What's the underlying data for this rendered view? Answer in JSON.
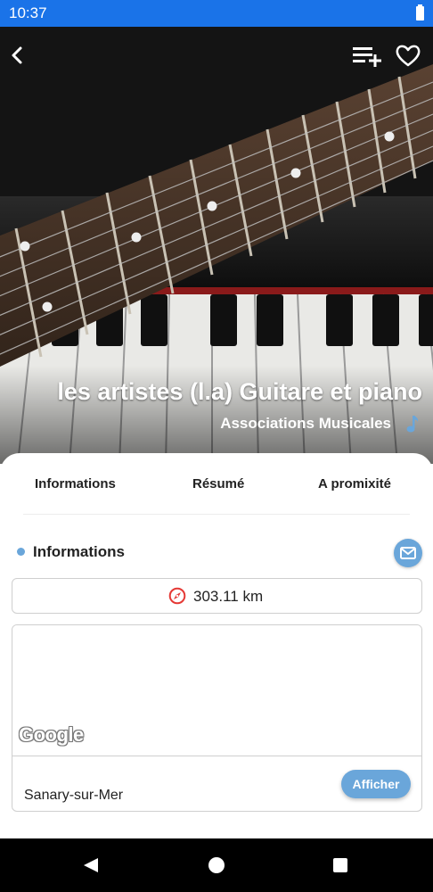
{
  "status_bar": {
    "time": "10:37"
  },
  "hero": {
    "title": "les artistes (l.a) Guitare et piano",
    "category": "Associations Musicales"
  },
  "tabs": [
    {
      "label": "Informations"
    },
    {
      "label": "Résumé"
    },
    {
      "label": "A promixité"
    }
  ],
  "info_section": {
    "title": "Informations",
    "distance": "303.11 km"
  },
  "map": {
    "attribution": "Google",
    "city": "Sanary-sur-Mer",
    "show_button": "Afficher"
  },
  "colors": {
    "status_bar": "#1a73e8",
    "accent": "#6aa6da",
    "compass": "#e53935"
  },
  "icons": [
    "back-arrow-icon",
    "playlist-add-icon",
    "heart-icon",
    "music-note-icon",
    "mail-icon",
    "compass-icon",
    "nav-back-icon",
    "nav-home-icon",
    "nav-recents-icon"
  ]
}
